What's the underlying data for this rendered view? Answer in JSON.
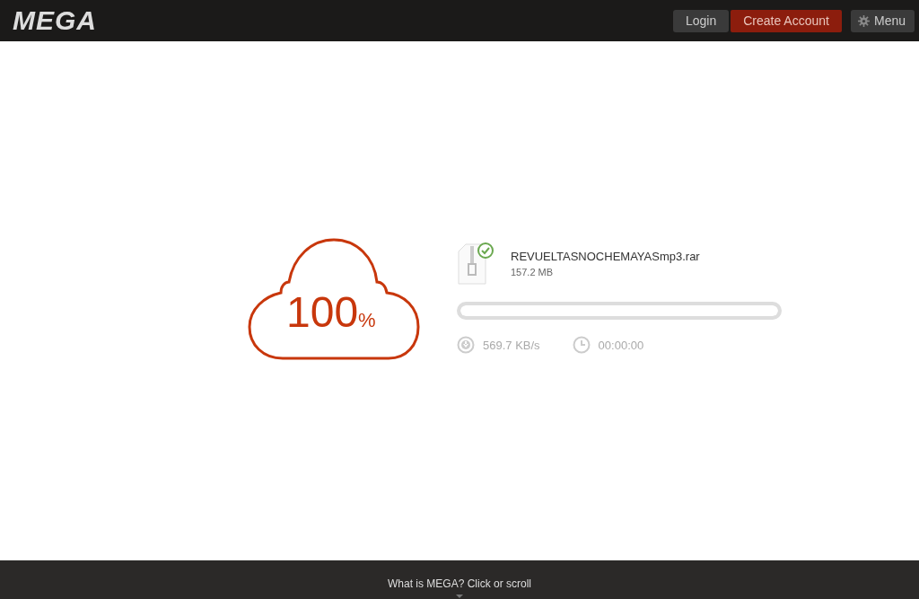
{
  "header": {
    "logo": "MEGA",
    "buttons": [
      {
        "label": "Login",
        "kind": "login"
      },
      {
        "label": "Create Account",
        "kind": "create"
      },
      {
        "label": "Menu",
        "kind": "menu"
      }
    ]
  },
  "download": {
    "percent": "100",
    "percent_sign": "%",
    "file_name": "REVUELTASNOCHEMAYASmp3.rar",
    "file_size": "157.2 MB",
    "complete": true,
    "progress": {
      "level": 1
    },
    "speed": "569.7 KB/s",
    "time_left": "00:00:00"
  },
  "footer": {
    "text": "What is MEGA? Click or scroll"
  }
}
